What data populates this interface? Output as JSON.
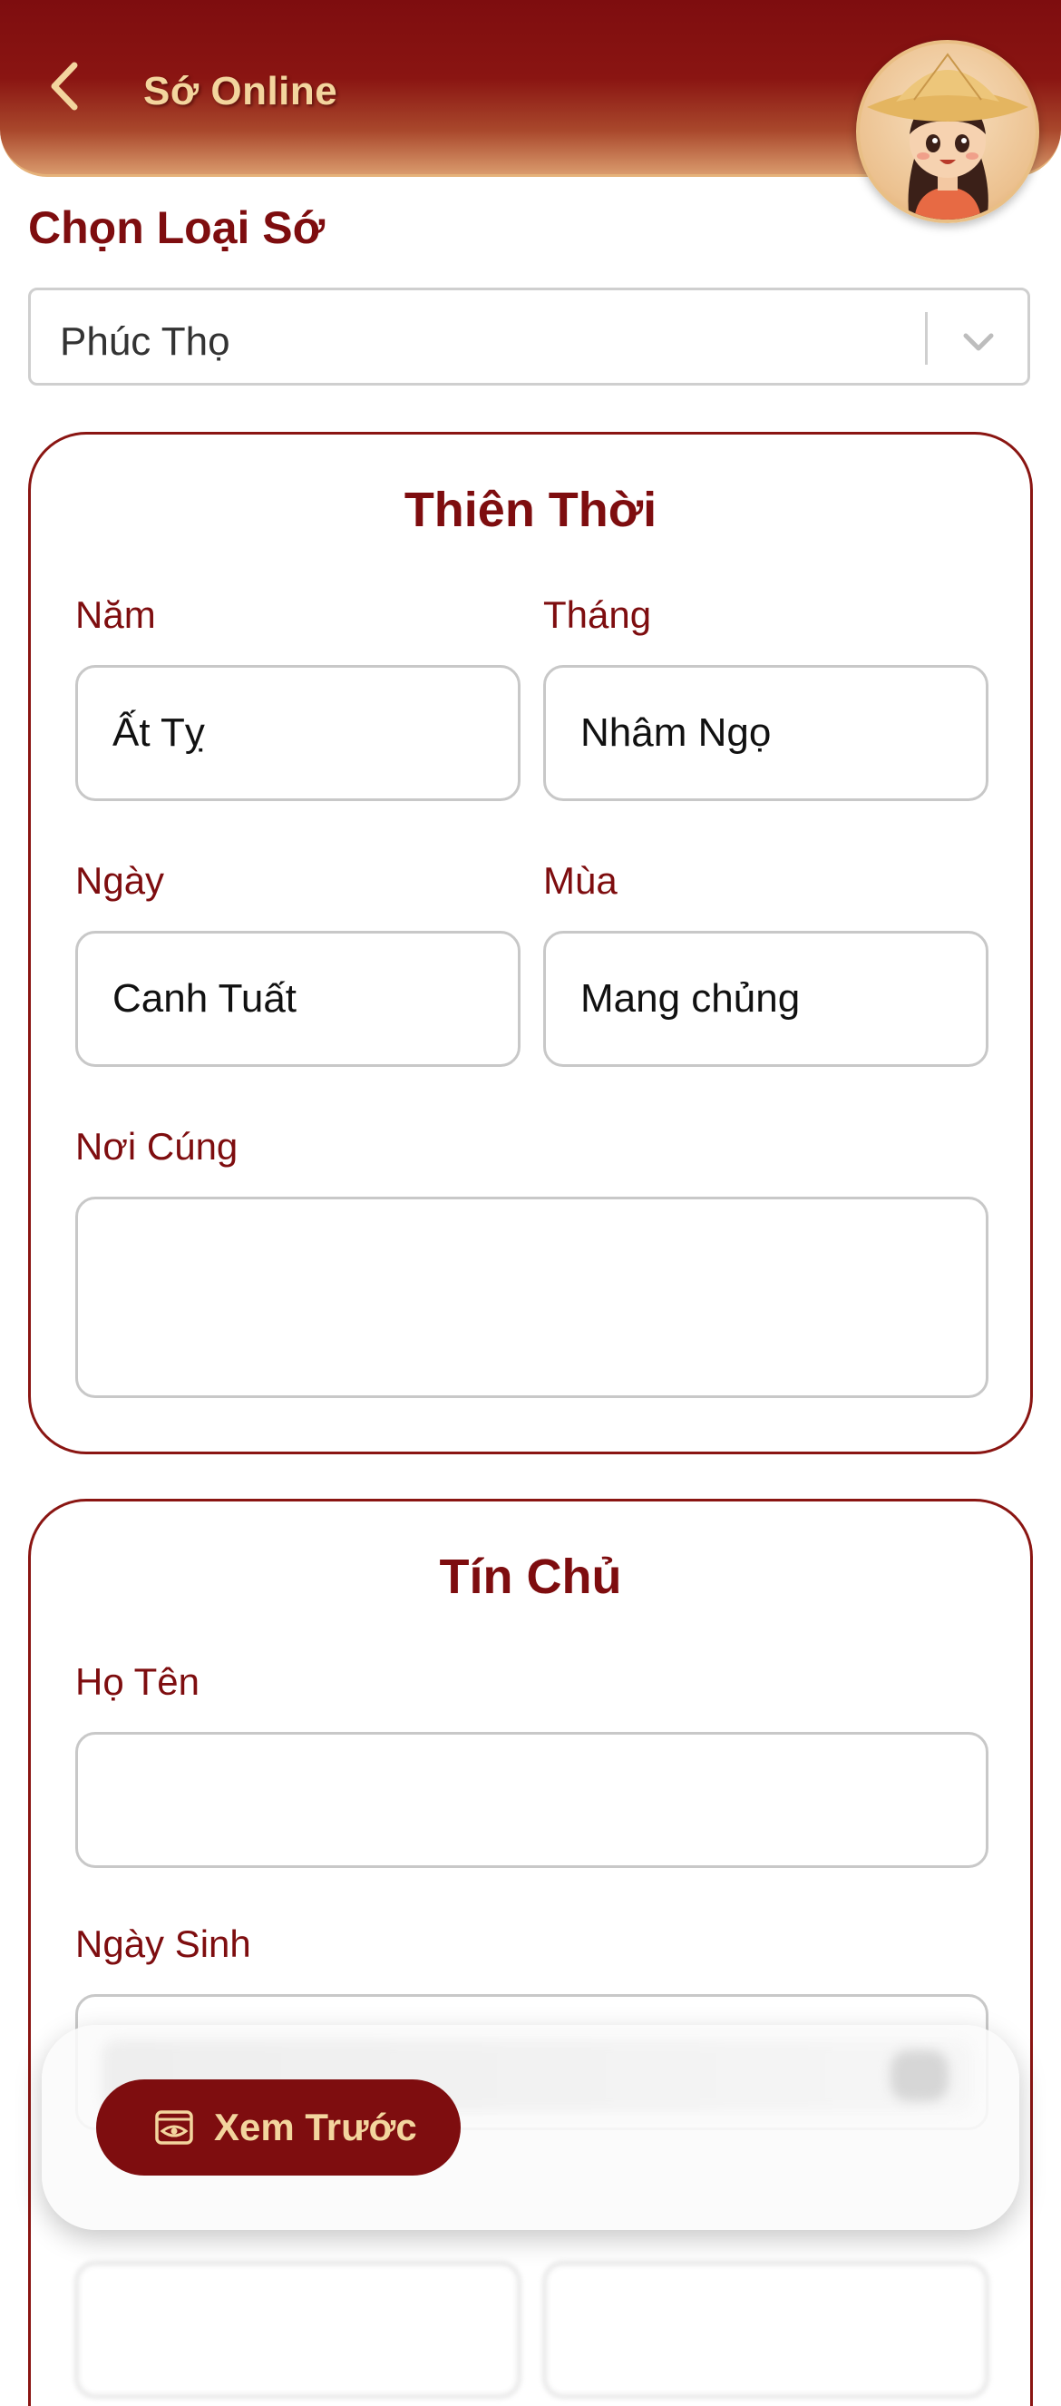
{
  "header": {
    "title": "Sớ Online"
  },
  "select": {
    "section_title": "Chọn Loại Sớ",
    "value": "Phúc Thọ"
  },
  "thien_thoi": {
    "title": "Thiên Thời",
    "fields": [
      {
        "label": "Năm",
        "value": "Ất Tỵ"
      },
      {
        "label": "Tháng",
        "value": "Nhâm Ngọ"
      },
      {
        "label": "Ngày",
        "value": "Canh Tuất"
      },
      {
        "label": "Mùa",
        "value": "Mang chủng"
      }
    ],
    "noi_cung_label": "Nơi Cúng",
    "noi_cung_value": ""
  },
  "tin_chu": {
    "title": "Tín Chủ",
    "ho_ten_label": "Họ Tên",
    "ho_ten_value": "",
    "ngay_sinh_label": "Ngày Sinh",
    "ngay_sinh_value": ""
  },
  "bottom": {
    "preview_label": "Xem Trước"
  },
  "colors": {
    "primary": "#7e0d0f",
    "accent_gold": "#f3d59e",
    "input_border": "#c8c8c8"
  },
  "icons": {
    "back": "chevron-left-icon",
    "dropdown": "chevron-down-icon",
    "preview": "eye-icon"
  }
}
